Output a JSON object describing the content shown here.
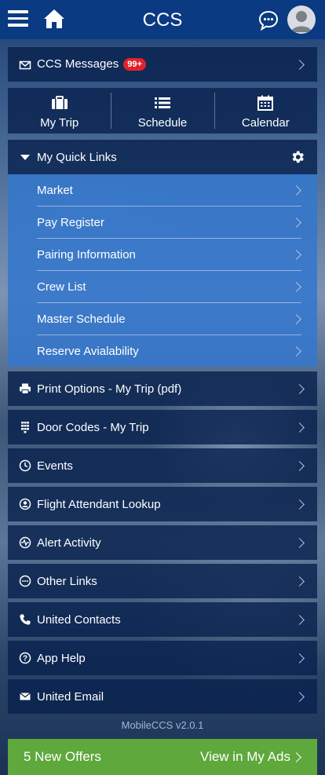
{
  "header": {
    "title": "CCS",
    "menu_icon": "hamburger-icon",
    "home_icon": "home-icon",
    "chat_icon": "chat-icon",
    "avatar_icon": "user-avatar-icon",
    "bar_color": "#0a3a82"
  },
  "messages": {
    "label": "CCS Messages",
    "badge": "99+",
    "icon": "envelope-icon"
  },
  "shortcuts": [
    {
      "label": "My Trip",
      "icon": "briefcase-icon"
    },
    {
      "label": "Schedule",
      "icon": "list-icon"
    },
    {
      "label": "Calendar",
      "icon": "calendar-icon"
    }
  ],
  "quick_links": {
    "title": "My Quick Links",
    "settings_icon": "gear-icon",
    "items": [
      "Market",
      "Pay Register",
      "Pairing Information",
      "Crew List",
      "Master Schedule",
      "Reserve Avialability"
    ]
  },
  "menu": [
    {
      "label": "Print Options - My Trip (pdf)",
      "icon": "printer-icon"
    },
    {
      "label": "Door Codes - My Trip",
      "icon": "keypad-icon"
    },
    {
      "label": "Events",
      "icon": "clock-icon"
    },
    {
      "label": "Flight Attendant Lookup",
      "icon": "person-search-icon"
    },
    {
      "label": "Alert Activity",
      "icon": "pulse-icon"
    },
    {
      "label": "Other Links",
      "icon": "more-dots-icon"
    },
    {
      "label": "United Contacts",
      "icon": "phone-icon"
    },
    {
      "label": "App Help",
      "icon": "help-icon"
    },
    {
      "label": "United Email",
      "icon": "mail-icon"
    }
  ],
  "version": "MobileCCS v2.0.1",
  "offers": {
    "left": "5 New Offers",
    "right": "View in My Ads",
    "color": "#5ea83c"
  }
}
